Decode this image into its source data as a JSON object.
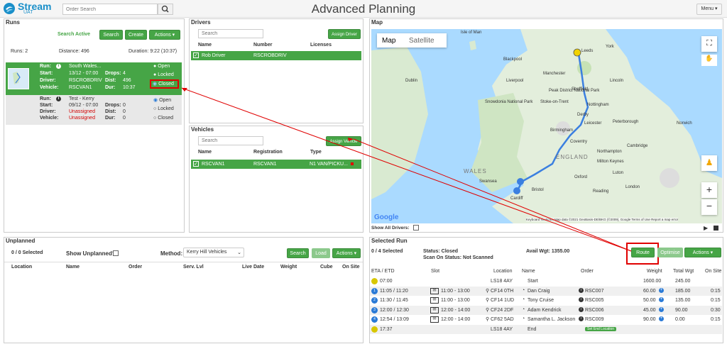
{
  "header": {
    "logo_text": "Stream",
    "logo_sub": "UAT",
    "order_search_placeholder": "Order Search",
    "title": "Advanced Planning",
    "menu_label": "Menu ▾"
  },
  "runs": {
    "title": "Runs",
    "search_active": "Search Active",
    "search_label": "Search",
    "create_label": "Create",
    "actions_label": "Actions ▾",
    "summary": {
      "runs": "Runs: 2",
      "distance": "Distance: 496",
      "duration": "Duration: 9:22 (10:37)"
    },
    "labels": {
      "run": "Run:",
      "start": "Start:",
      "driver": "Driver:",
      "vehicle": "Vehicle:",
      "drops": "Drops:",
      "dist": "Dist:",
      "dur": "Dur:"
    },
    "status_options": [
      "Open",
      "Locked",
      "Closed"
    ],
    "items": [
      {
        "name": "South Wales...",
        "start": "13/12 - 07:00",
        "driver": "RSCROBDRIV",
        "vehicle": "RSCVAN1",
        "drops": "4",
        "dist": "496",
        "dur": "10:37",
        "status": "Closed"
      },
      {
        "name": "Test - Kerry",
        "start": "09/12 - 07:00",
        "driver": "Unassigned",
        "vehicle": "Unassigned",
        "drops": "0",
        "dist": "0",
        "dur": "0",
        "status": "Open"
      }
    ]
  },
  "drivers": {
    "title": "Drivers",
    "search_placeholder": "Search",
    "assign_label": "Assign Driver",
    "columns": [
      "Name",
      "Number",
      "Licenses"
    ],
    "rows": [
      {
        "name": "Rob Driver",
        "number": "RSCROBDRIV",
        "licenses": ""
      }
    ]
  },
  "vehicles": {
    "title": "Vehicles",
    "search_placeholder": "Search",
    "assign_label": "Assign Vehicle",
    "columns": [
      "Name",
      "Registration",
      "Type"
    ],
    "rows": [
      {
        "name": "RSCVAN1",
        "registration": "RSCVAN1",
        "type": "N1 VAN/PICKU..."
      }
    ]
  },
  "map": {
    "title": "Map",
    "tab_map": "Map",
    "tab_satellite": "Satellite",
    "show_all_drivers": "Show All Drivers:",
    "google": "Google",
    "attribution": "Keyboard shortcuts   Map data ©2021 GeoBasis-DE/BKG (©2009), Google   Terms of Use   Report a map error",
    "places": [
      "Isle of Man",
      "Leeds",
      "York",
      "Manchester",
      "Sheffield",
      "Liverpool",
      "Blackpool",
      "Dublin",
      "Snowdonia National Park",
      "Peak District National Park",
      "Nottingham",
      "Derby",
      "Leicester",
      "Birmingham",
      "Coventry",
      "ENGLAND",
      "WALES",
      "Cambridge",
      "Oxford",
      "London",
      "Swansea",
      "Cardiff",
      "Bristol",
      "Reading",
      "Norwich",
      "Peterborough",
      "Northampton",
      "Milton Keynes",
      "Luton",
      "Stoke-on-Trent",
      "Lincoln"
    ]
  },
  "unplanned": {
    "title": "Unplanned",
    "selected": "0 / 0 Selected",
    "show_label": "Show Unplanned?",
    "method_label": "Method:",
    "method_value": "Kerry Hill Vehicles",
    "search_label": "Search",
    "load_label": "Load",
    "actions_label": "Actions ▾",
    "columns": [
      "Location",
      "Name",
      "Order",
      "Serv. Lvl",
      "Live Date",
      "Weight",
      "Cube",
      "On Site"
    ]
  },
  "selected_run": {
    "title": "Selected Run",
    "selected": "0 / 4 Selected",
    "status": "Status: Closed",
    "scan_status": "Scan On Status: Not Scanned",
    "avail_wgt": "Avail Wgt: 1355.00",
    "route_label": "Route",
    "optimise_label": "Optimise",
    "actions_label": "Actions ▾",
    "columns": [
      "ETA / ETD",
      "Slot",
      "Location",
      "Name",
      "Order",
      "Weight",
      "Total Wgt",
      "On Site"
    ],
    "rows": [
      {
        "eta": "07:00",
        "slot": "",
        "location": "LS18 4AY",
        "name": "Start",
        "order": "",
        "weight": "1600.00",
        "total": "245.00",
        "onsite": "",
        "kind": "start"
      },
      {
        "eta": "11:05 / 11:20",
        "slot": "11:00 - 13:00",
        "location": "CF14 0TH",
        "name": "Dan Craig",
        "order": "RSC007",
        "weight": "60.00",
        "total": "185.00",
        "onsite": "0:15",
        "kind": "drop",
        "num": "1"
      },
      {
        "eta": "11:30 / 11:45",
        "slot": "11:00 - 13:00",
        "location": "CF14 1UD",
        "name": "Tony Cruise",
        "order": "RSC005",
        "weight": "50.00",
        "total": "135.00",
        "onsite": "0:15",
        "kind": "drop",
        "num": "2"
      },
      {
        "eta": "12:00 / 12:30",
        "slot": "12:00 - 14:00",
        "location": "CF24 2DF",
        "name": "Adam Kendrick",
        "order": "RSC006",
        "weight": "45.00",
        "total": "90.00",
        "onsite": "0:30",
        "kind": "drop",
        "num": "3"
      },
      {
        "eta": "12:54 / 13:09",
        "slot": "12:00 - 14:00",
        "location": "CF62 5AD",
        "name": "Samantha L. Jackson",
        "order": "RSC009",
        "weight": "90.00",
        "total": "0.00",
        "onsite": "0:15",
        "kind": "drop",
        "num": "4"
      },
      {
        "eta": "17:37",
        "slot": "",
        "location": "LS18 4AY",
        "name": "End",
        "order": "Set End Location",
        "weight": "",
        "total": "",
        "onsite": "",
        "kind": "end"
      }
    ]
  },
  "colors": {
    "green": "#46a546",
    "red_annotation": "#e00000",
    "brand": "#1a8fc9",
    "route": "#3b7fe0"
  }
}
